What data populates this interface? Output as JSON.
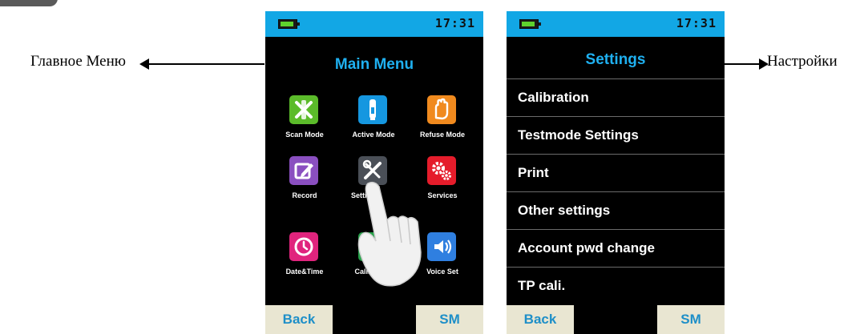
{
  "annotations": {
    "left_label": "Главное Меню",
    "right_label": "Настройки"
  },
  "main_menu_screen": {
    "status": {
      "time": "17:31",
      "battery_icon": "battery-icon"
    },
    "title": "Main Menu",
    "items": [
      {
        "label": "Scan Mode",
        "icon": "scan-mode-icon",
        "color": "#5bbb2a"
      },
      {
        "label": "Active Mode",
        "icon": "active-mode-icon",
        "color": "#1597e0"
      },
      {
        "label": "Refuse Mode",
        "icon": "refuse-mode-icon",
        "color": "#f08a1e"
      },
      {
        "label": "Record",
        "icon": "record-icon",
        "color": "#8a4fc0"
      },
      {
        "label": "Setti",
        "icon": "settings-icon",
        "color": "#4a4f57"
      },
      {
        "label": "Services",
        "icon": "services-icon",
        "color": "#e51c2b"
      },
      {
        "label": "Date&Time",
        "icon": "clock-icon",
        "color": "#e0247d"
      },
      {
        "label": "Calibration",
        "icon": "calibration-icon",
        "color": "#27a14a"
      },
      {
        "label": "Voice Set",
        "icon": "speaker-icon",
        "color": "#2f7fe0"
      }
    ],
    "back_label": "Back",
    "sm_label": "SM"
  },
  "settings_screen": {
    "status": {
      "time": "17:31",
      "battery_icon": "battery-icon"
    },
    "title": "Settings",
    "items": [
      "Calibration",
      "Testmode Settings",
      "Print",
      "Other settings",
      "Account pwd change",
      "TP cali."
    ],
    "back_label": "Back",
    "sm_label": "SM"
  },
  "colors": {
    "status_bar": "#12a7e5",
    "title_text": "#1fb0f0",
    "soft_key_bg": "#e9e6d2",
    "soft_key_text": "#1e8fc8"
  }
}
